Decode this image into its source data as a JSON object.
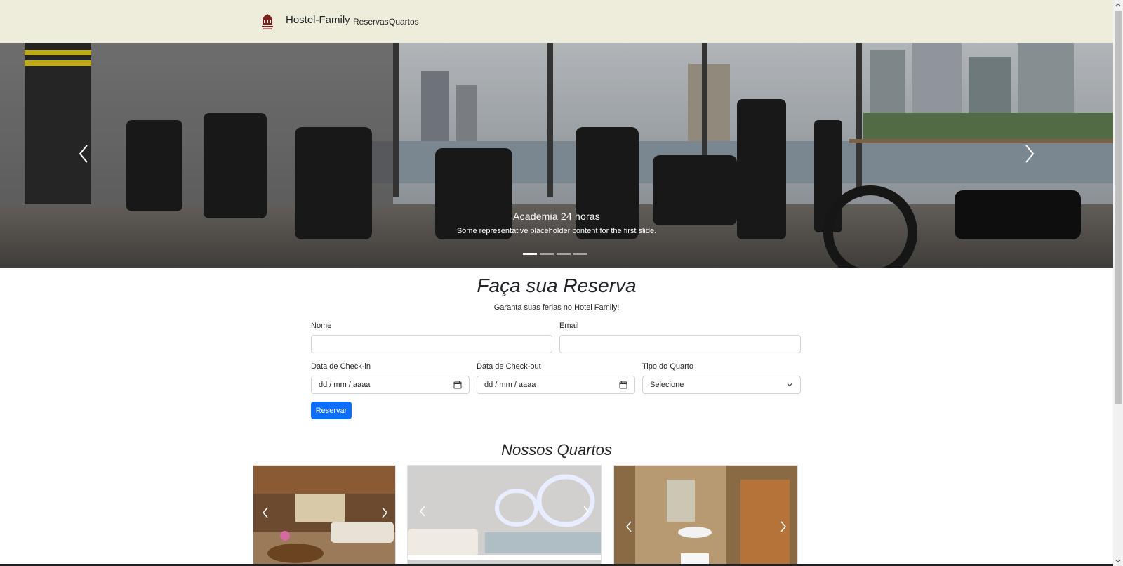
{
  "navbar": {
    "brand": "Hostel-Family",
    "logo_icon": "hotel-logo-icon",
    "links": [
      "Reservas",
      "Quartos"
    ]
  },
  "hero": {
    "caption_title": "Academia 24 horas",
    "caption_text": "Some representative placeholder content for the first slide.",
    "indicator_count": 4,
    "active_indicator": 1
  },
  "booking": {
    "title": "Faça sua Reserva",
    "subtitle": "Garanta suas ferias no Hotel Family!",
    "name_label": "Nome",
    "email_label": "Email",
    "checkin_label": "Data de Check-in",
    "checkout_label": "Data de Check-out",
    "room_type_label": "Tipo do Quarto",
    "date_placeholder": "dd / mm / aaaa",
    "room_type_value": "Selecione",
    "submit_label": "Reservar"
  },
  "rooms": {
    "title": "Nossos Quartos"
  },
  "colors": {
    "navbar_bg": "#eeecdb",
    "primary": "#0d6efd"
  }
}
